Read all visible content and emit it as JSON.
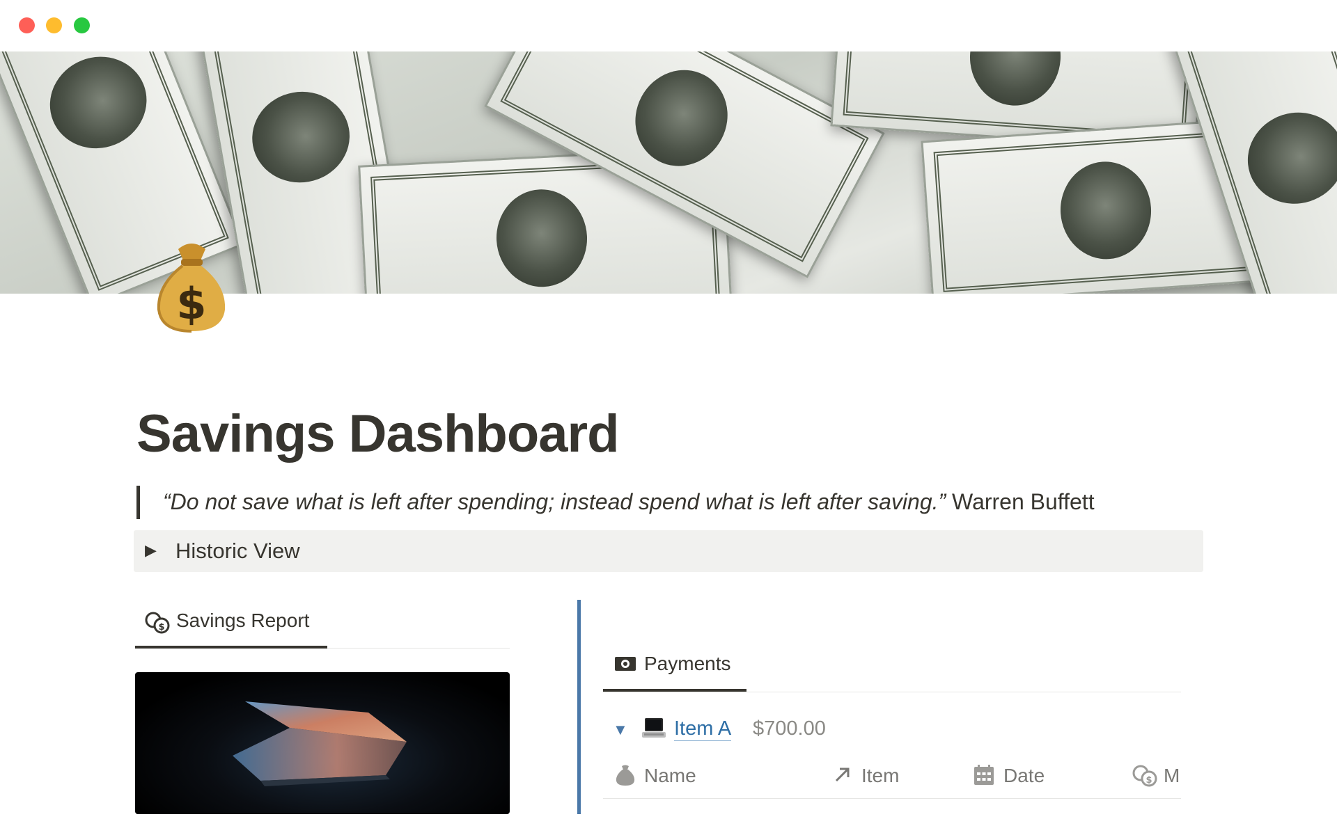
{
  "page": {
    "title": "Savings Dashboard",
    "icon": "money-bag-icon"
  },
  "quote": {
    "text": "“Do not save what is left after spending; instead spend what is left after saving.”",
    "author": "Warren Buffett"
  },
  "toggle": {
    "label": "Historic View",
    "expanded": false
  },
  "left_panel": {
    "tab_label": "Savings Report",
    "tab_icon": "coins-icon"
  },
  "right_panel": {
    "tab_label": "Payments",
    "tab_icon": "banknote-icon",
    "group": {
      "name": "Item A",
      "amount": "$700.00",
      "icon": "laptop-icon",
      "expanded": true
    },
    "columns": [
      {
        "label": "Name",
        "icon": "money-bag-icon"
      },
      {
        "label": "Item",
        "icon": "relation-arrow-icon"
      },
      {
        "label": "Date",
        "icon": "calendar-icon"
      },
      {
        "label": "M",
        "icon": "coins-icon"
      }
    ]
  },
  "colors": {
    "text": "#37352f",
    "accent_divider": "#4a78a8",
    "link": "#2f6fa6",
    "toggle_bg": "#f1f1ef"
  }
}
